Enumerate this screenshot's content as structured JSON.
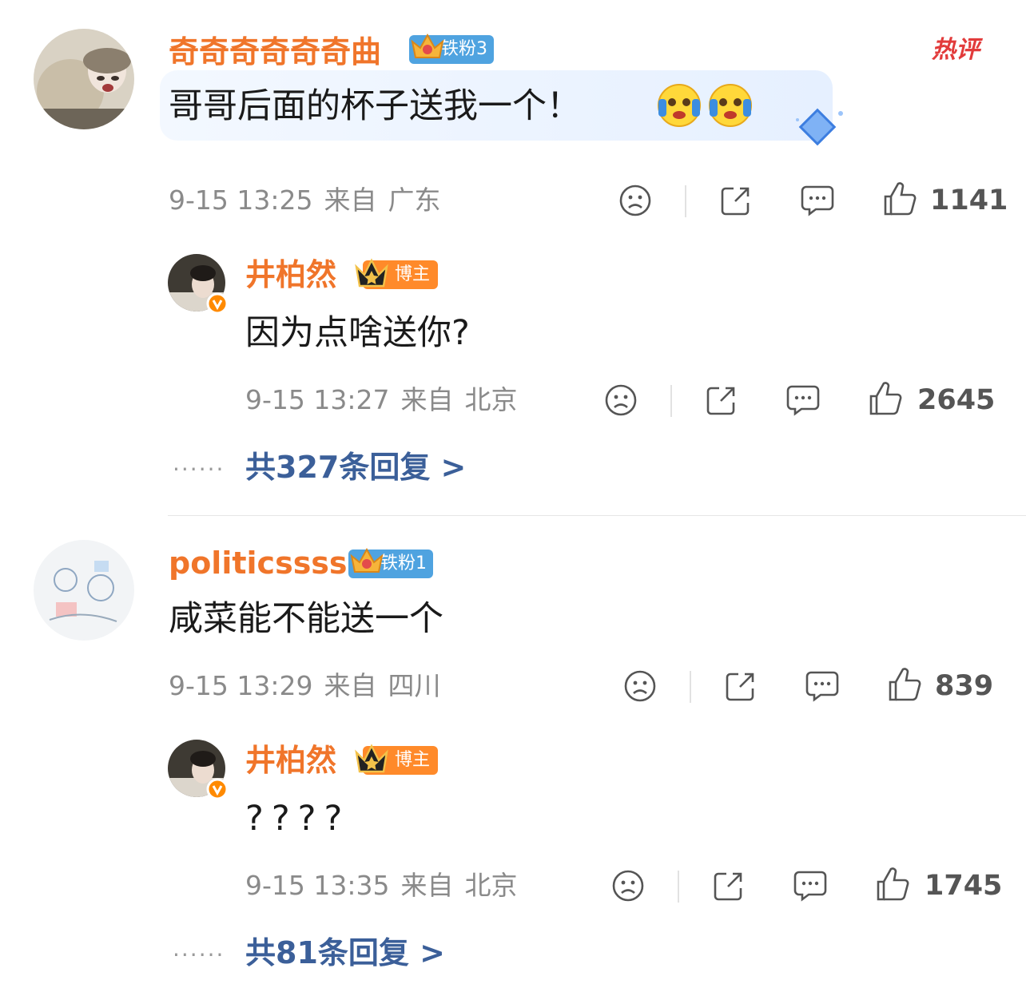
{
  "comments": [
    {
      "username": "奇奇奇奇奇奇曲",
      "fan_badge": "铁粉3",
      "hot_label": "热评",
      "text": "哥哥后面的杯子送我一个！",
      "time": "9-15 13:25",
      "from": "来自",
      "location": "广东",
      "likes": "1141",
      "reply": {
        "username": "井柏然",
        "badge": "博主",
        "text": "因为点啥送你?",
        "time": "9-15 13:27",
        "from": "来自",
        "location": "北京",
        "likes": "2645"
      },
      "more_dots": "······",
      "more_replies": "共327条回复 >"
    },
    {
      "username": "politicssss",
      "fan_badge": "铁粉1",
      "text": "咸菜能不能送一个",
      "time": "9-15 13:29",
      "from": "来自",
      "location": "四川",
      "likes": "839",
      "reply": {
        "username": "井柏然",
        "badge": "博主",
        "text": "????",
        "time": "9-15 13:35",
        "from": "来自",
        "location": "北京",
        "likes": "1745"
      },
      "more_dots": "······",
      "more_replies": "共81条回复 >"
    }
  ],
  "colors": {
    "username": "#f0752a",
    "reply_link": "#3b5f99",
    "fan_badge": "#4fa3e0",
    "blogger_badge": "#ff8a2a",
    "hot": "#e23b3b",
    "verified": "#ff8a00"
  },
  "icons": [
    "sad-face-icon",
    "share-icon",
    "comment-icon",
    "like-thumb-icon",
    "crown-icon",
    "verified-v-icon",
    "emoji-icon"
  ]
}
